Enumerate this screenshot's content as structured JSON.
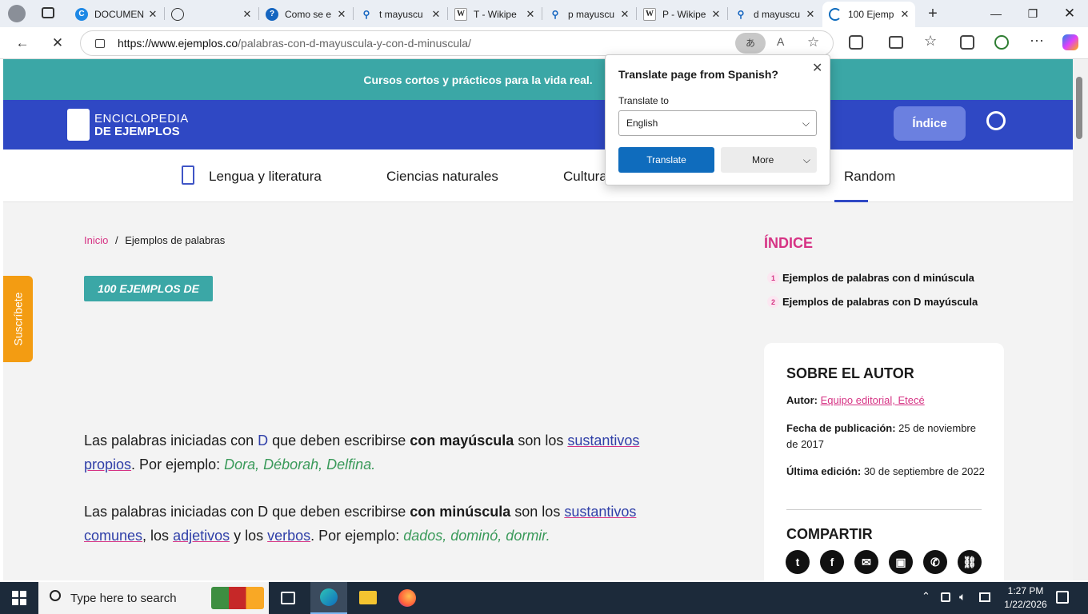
{
  "browser": {
    "tabs": [
      {
        "title": "DOCUMEN",
        "icon": "copilot-doc-icon"
      },
      {
        "title": "",
        "icon": "globe-icon"
      },
      {
        "title": "Como se e",
        "icon": "help-icon"
      },
      {
        "title": "t mayuscu",
        "icon": "search-icon"
      },
      {
        "title": "T - Wikipe",
        "icon": "wikipedia-icon"
      },
      {
        "title": "p mayuscu",
        "icon": "search-icon"
      },
      {
        "title": "P - Wikipe",
        "icon": "wikipedia-icon"
      },
      {
        "title": "d mayuscu",
        "icon": "search-icon"
      },
      {
        "title": "100 Ejemp",
        "icon": "loading-icon"
      }
    ],
    "url_domain": "https://www.ejemplos.co",
    "url_path": "/palabras-con-d-mayuscula-y-con-d-minuscula/"
  },
  "translate_popup": {
    "title": "Translate page from Spanish?",
    "translate_to_label": "Translate to",
    "language": "English",
    "translate_button": "Translate",
    "more_button": "More"
  },
  "site": {
    "promo": "Cursos cortos y prácticos para la vida real.",
    "logo_line1": "ENCICLOPEDIA",
    "logo_line2": "DE EJEMPLOS",
    "index_button": "Índice",
    "nav": [
      "Lengua y literatura",
      "Ciencias naturales",
      "Cultura",
      "Random"
    ],
    "subscribe": "Suscríbete"
  },
  "article": {
    "breadcrumb_home": "Inicio",
    "breadcrumb_sep": "/",
    "breadcrumb_current": "Ejemplos de palabras",
    "badge": "100 EJEMPLOS DE",
    "p1": {
      "a": "Las palabras iniciadas con ",
      "d": "D",
      "b": " que deben escribirse ",
      "bold": "con mayúscula",
      "c": " son los ",
      "link": "sustantivos propios",
      "e": ". Por ejemplo: ",
      "ex": "Dora, Déborah, Delfina."
    },
    "p2": {
      "a": "Las palabras iniciadas con D que deben escribirse ",
      "bold": "con minúscula",
      "b": " son los ",
      "link1": "sustantivos comunes",
      "c": ", los ",
      "link2": "adjetivos",
      "d": " y los ",
      "link3": "verbos",
      "e": ". Por ejemplo: ",
      "ex": "dados, dominó, dormir."
    }
  },
  "sidebar": {
    "index_title": "ÍNDICE",
    "toc": [
      {
        "n": "1",
        "label": "Ejemplos de palabras con d minúscula"
      },
      {
        "n": "2",
        "label": "Ejemplos de palabras con D mayúscula"
      }
    ],
    "author_title": "SOBRE EL AUTOR",
    "author_label": "Autor:",
    "author_name": "Equipo editorial, Etecé",
    "pub_label": "Fecha de publicación:",
    "pub_date": "25 de noviembre de 2017",
    "edit_label": "Última edición:",
    "edit_date": "30 de septiembre de 2022",
    "share_title": "COMPARTIR"
  },
  "taskbar": {
    "search_placeholder": "Type here to search",
    "time": "1:27 PM",
    "date": "1/22/2026"
  },
  "colors": {
    "teal": "#3ba7a6",
    "blue": "#2f48c4",
    "pink": "#d63384",
    "green": "#3a9a5a",
    "edge_blue": "#0f6cbd"
  }
}
